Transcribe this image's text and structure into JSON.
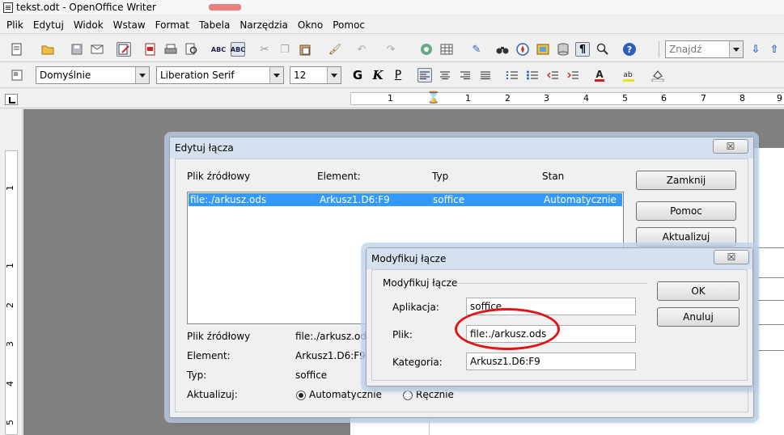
{
  "window": {
    "title": "tekst.odt - OpenOffice Writer"
  },
  "menu": [
    "Plik",
    "Edytuj",
    "Widok",
    "Wstaw",
    "Format",
    "Tabela",
    "Narzędzia",
    "Okno",
    "Pomoc"
  ],
  "toolbar": {
    "search_placeholder": "Znajdź",
    "style": "Domyślnie",
    "font": "Liberation Serif",
    "size": "12",
    "bold": "G",
    "italic": "K",
    "underline": "P"
  },
  "ruler": {
    "h_numbers": [
      "1",
      "1",
      "2",
      "3",
      "4",
      "5",
      "6",
      "7",
      "8",
      "9"
    ],
    "v_numbers": [
      "1",
      "1",
      "2",
      "3",
      "4",
      "5"
    ]
  },
  "edit_links": {
    "title": "Edytuj łącza",
    "col_source": "Plik źródłowy",
    "col_element": "Element:",
    "col_type": "Typ",
    "col_state": "Stan",
    "row": {
      "source": "file:./arkusz.ods",
      "element": "Arkusz1.D6:F9",
      "type": "soffice",
      "state": "Automatycznie"
    },
    "detail_source_label": "Plik źródłowy",
    "detail_source": "file:./arkusz.ods",
    "detail_element_label": "Element:",
    "detail_element": "Arkusz1.D6:F9",
    "detail_type_label": "Typ:",
    "detail_type": "soffice",
    "update_label": "Aktualizuj:",
    "auto_label": "Automatycznie",
    "manual_label": "Ręcznie",
    "btn_close": "Zamknij",
    "btn_help": "Pomoc",
    "btn_update": "Aktualizuj",
    "close_glyph": "☒"
  },
  "modify_link": {
    "title": "Modyfikuj łącze",
    "group": "Modyfikuj łącze",
    "app_label": "Aplikacja:",
    "app_value": "soffice",
    "file_label": "Plik:",
    "file_value": "file:./arkusz.ods",
    "category_label": "Kategoria:",
    "category_value": "Arkusz1.D6:F9",
    "btn_ok": "OK",
    "btn_cancel": "Anuluj",
    "close_glyph": "☒"
  },
  "annotation_color": "#e01515"
}
